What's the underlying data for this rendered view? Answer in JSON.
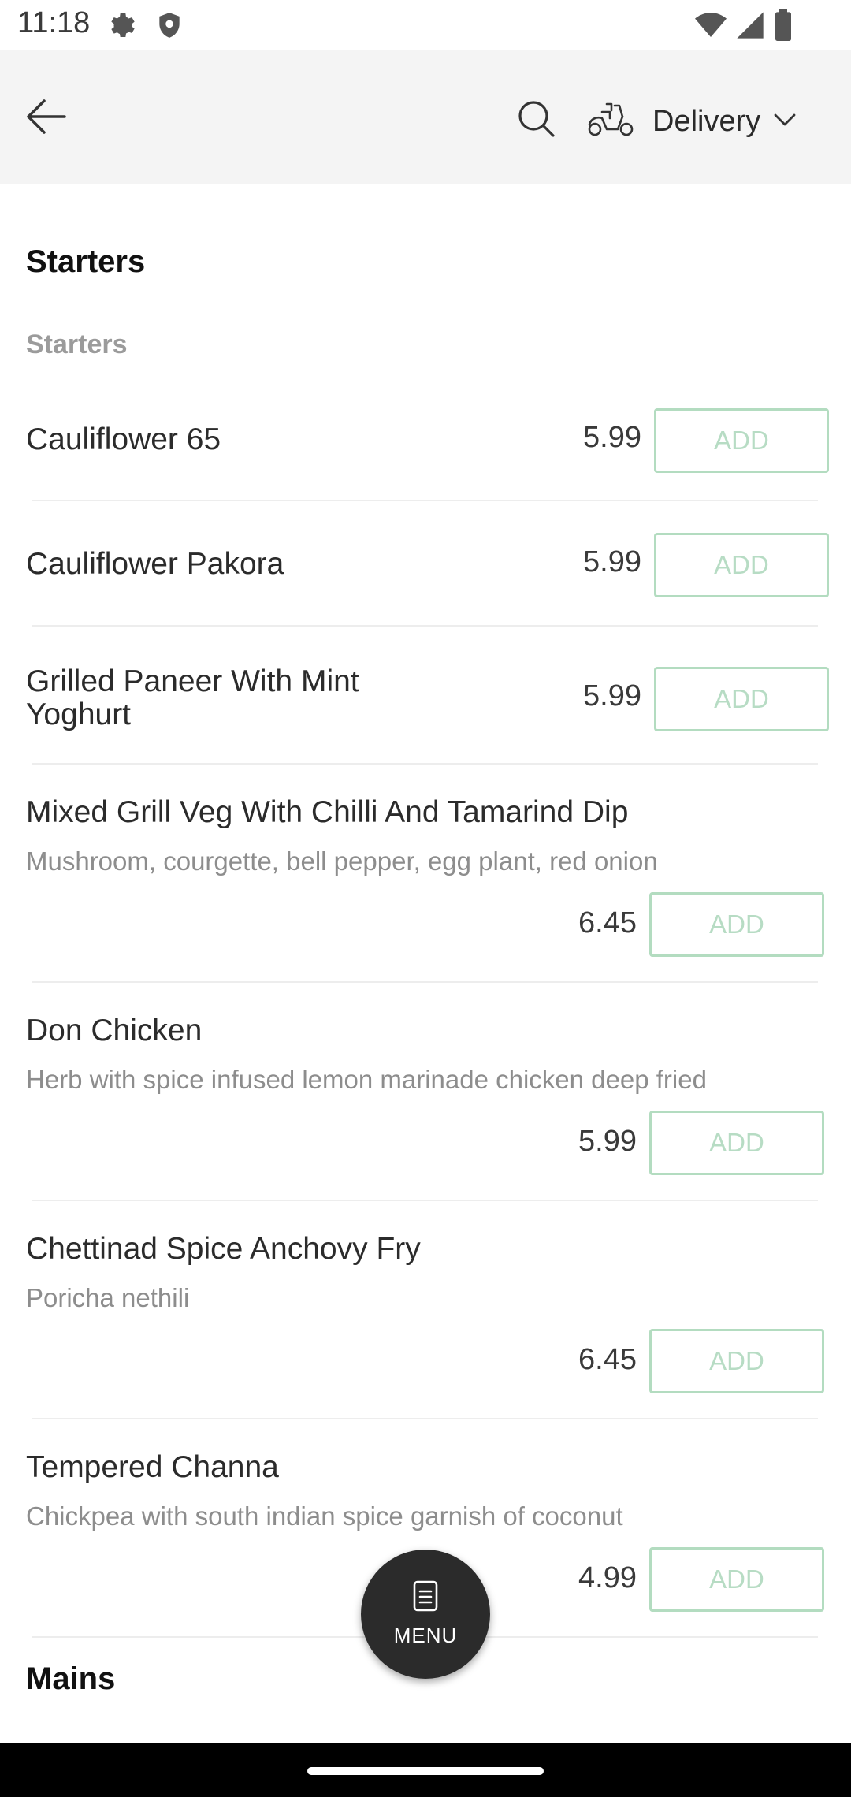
{
  "status_bar": {
    "time": "11:18",
    "icons": [
      "gear-icon",
      "shield-icon",
      "wifi-icon",
      "signal-icon",
      "battery-icon"
    ]
  },
  "app_bar": {
    "back_icon": "arrow-left-icon",
    "search_icon": "search-icon",
    "delivery_icon": "scooter-icon",
    "delivery_label": "Delivery",
    "dropdown_icon": "chevron-down-icon"
  },
  "menu": {
    "section_title": "Starters",
    "subsection_title": "Starters",
    "add_label": "ADD",
    "items": [
      {
        "name": "Cauliflower 65",
        "desc": "",
        "price": "5.99"
      },
      {
        "name": "Cauliflower Pakora",
        "desc": "",
        "price": "5.99"
      },
      {
        "name": "Grilled Paneer With Mint Yoghurt",
        "desc": "",
        "price": "5.99"
      },
      {
        "name": "Mixed Grill Veg With Chilli And Tamarind Dip",
        "desc": "Mushroom, courgette, bell pepper, egg plant, red onion",
        "price": "6.45"
      },
      {
        "name": "Don Chicken",
        "desc": "Herb with spice infused lemon marinade chicken deep fried",
        "price": "5.99"
      },
      {
        "name": "Chettinad Spice Anchovy Fry",
        "desc": "Poricha nethili",
        "price": "6.45"
      },
      {
        "name": "Tempered Channa",
        "desc": "Chickpea with south indian spice garnish of coconut",
        "price": "4.99"
      }
    ],
    "next_section_title": "Mains"
  },
  "fab": {
    "label": "MENU",
    "icon": "menu-book-icon"
  },
  "colors": {
    "accent_border": "#b3dcc0",
    "accent_text": "#b7dcc4",
    "app_bar_bg": "#f4f4f4",
    "fab_bg": "#2b2b2b"
  }
}
